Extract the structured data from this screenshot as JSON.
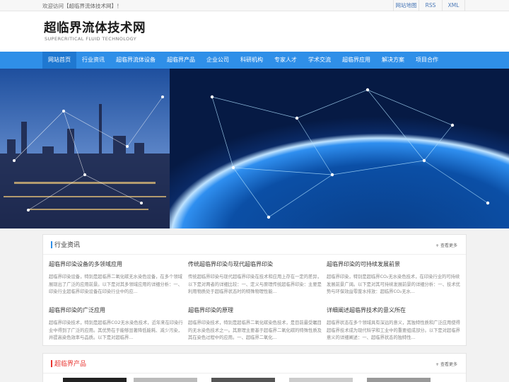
{
  "topbar": {
    "welcome": "欢迎访问【超临界流体技术网】！",
    "links": [
      "网站地图",
      "RSS",
      "XML"
    ]
  },
  "header": {
    "title": "超临界流体技术网",
    "subtitle": "SUPERCRITICAL FLUID TECHNOLOGY"
  },
  "nav": {
    "items": [
      "网站首页",
      "行业资讯",
      "超临界流体设备",
      "超临界产品",
      "企业公司",
      "科研机构",
      "专家人才",
      "学术交流",
      "超临界应用",
      "解决方案",
      "项目合作"
    ]
  },
  "news_section": {
    "title": "行业资讯",
    "more": "+ 查看更多",
    "items": [
      {
        "title": "超临界印染设备的多领域应用",
        "desc": "超临界印染设备，特别是超临界二氧化碳无水染色设备，在多个领域展现出了广泛的应用前景。以下是对其多领域应用的详细分析：一、印染行业超临界印染设备在印染行业中的应..."
      },
      {
        "title": "传统超临界印染与现代超临界印染",
        "desc": "传统超临界印染与现代超临界印染在技术和应用上存在一定的差异，以下是对两者的详细比较：一、定义与原理传统超临界印染：主要是利用物质处于超临界状态时的特殊物理性能..."
      },
      {
        "title": "超临界印染的可持续发展前景",
        "desc": "超临界印染，特别是超临界CO₂无水染色技术，在印染行业的可持续发展前景广阔。以下是对其可持续发展前景的详细分析：一、技术优势与环保效益零废水排放：超临界CO₂无水..."
      },
      {
        "title": "超临界印染的广泛应用",
        "desc": "超临界印染技术，特别是超临界CO2无水染色技术，近年来在印染行业中得到了广泛的应用。其优势在于能够显著降低能耗、减少污染，并提高染色效率与品质。以下是对超临界..."
      },
      {
        "title": "超临界印染的原理",
        "desc": "超临界印染技术，特别是超临界二氧化碳染色技术，是目前最受瞩目的无水染色技术之一。其原理主要基于超临界二氧化碳的特殊性质及其在染色过程中的应用。一、超临界二氧化..."
      },
      {
        "title": "详细阐述超临界技术的意义所在",
        "desc": "超临界状态在多个领域具有深远的意义，其独特性质和广泛应用使得超临界技术成为现代科学和工业中的重要组成部分。以下是对超临界意义的详细阐述：一、超临界状态的独特性..."
      }
    ]
  },
  "product_section": {
    "title": "超临界产品",
    "more": "+ 查看更多"
  },
  "colors": {
    "nav_bg": "#2f8fe8",
    "accent_red": "#e8342f",
    "link_blue": "#4a78b7"
  }
}
